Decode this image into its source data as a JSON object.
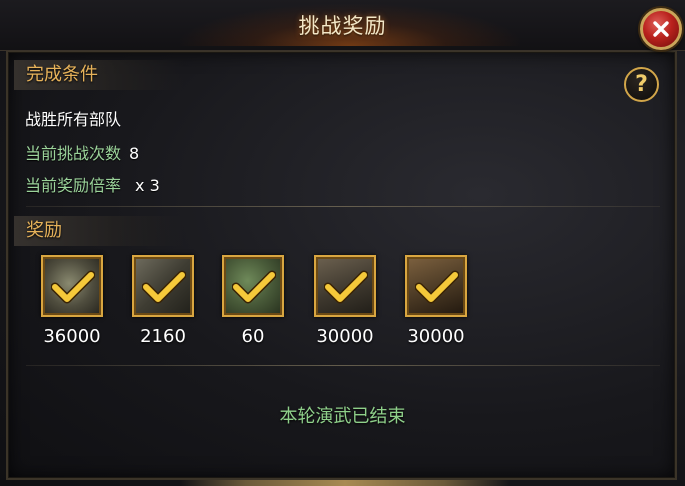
{
  "dialog": {
    "title": "挑战奖励"
  },
  "conditions": {
    "header": "完成条件",
    "requirement": "战胜所有部队",
    "challenge_count_label": "当前挑战次数",
    "challenge_count_value": "8",
    "multiplier_label": "当前奖励倍率",
    "multiplier_value": "x 3"
  },
  "rewards": {
    "header": "奖励",
    "items": [
      {
        "icon": "coin-icon",
        "amount": "36000"
      },
      {
        "icon": "cargo-icon",
        "amount": "2160"
      },
      {
        "icon": "scroll-icon",
        "amount": "60"
      },
      {
        "icon": "lumber-icon",
        "amount": "30000"
      },
      {
        "icon": "stone-icon",
        "amount": "30000"
      }
    ]
  },
  "status_text": "本轮演武已结束",
  "colors": {
    "accent_gold": "#e6b25a",
    "status_green": "#8fd08a",
    "close_red": "#b9221d"
  }
}
